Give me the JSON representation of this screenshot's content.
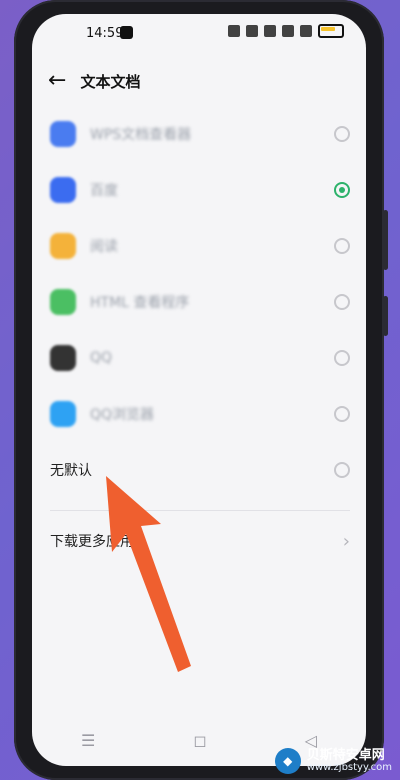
{
  "status": {
    "time": "14:59"
  },
  "header": {
    "title": "文本文档"
  },
  "apps": [
    {
      "name": "WPS文档查看器",
      "icon": "wps-doc-icon",
      "color": "#4a7cf0",
      "checked": false
    },
    {
      "name": "百度",
      "icon": "baidu-icon",
      "color": "#3b6cf0",
      "checked": true
    },
    {
      "name": "阅读",
      "icon": "reader-icon",
      "color": "#f4b23a",
      "checked": false
    },
    {
      "name": "HTML 查看程序",
      "icon": "android-icon",
      "color": "#4bbf63",
      "checked": false
    },
    {
      "name": "QQ",
      "icon": "qq-icon",
      "color": "#333333",
      "checked": false
    },
    {
      "name": "QQ浏览器",
      "icon": "qq-browser-icon",
      "color": "#2ea2f3",
      "checked": false
    }
  ],
  "no_default": {
    "label": "无默认",
    "checked": false
  },
  "download": {
    "label": "下载更多应用"
  },
  "watermark": {
    "title": "贝斯特安卓网",
    "url": "www.zjbstyy.com"
  },
  "colors": {
    "accent_green": "#2db26b",
    "arrow_orange": "#ef5f2f"
  }
}
